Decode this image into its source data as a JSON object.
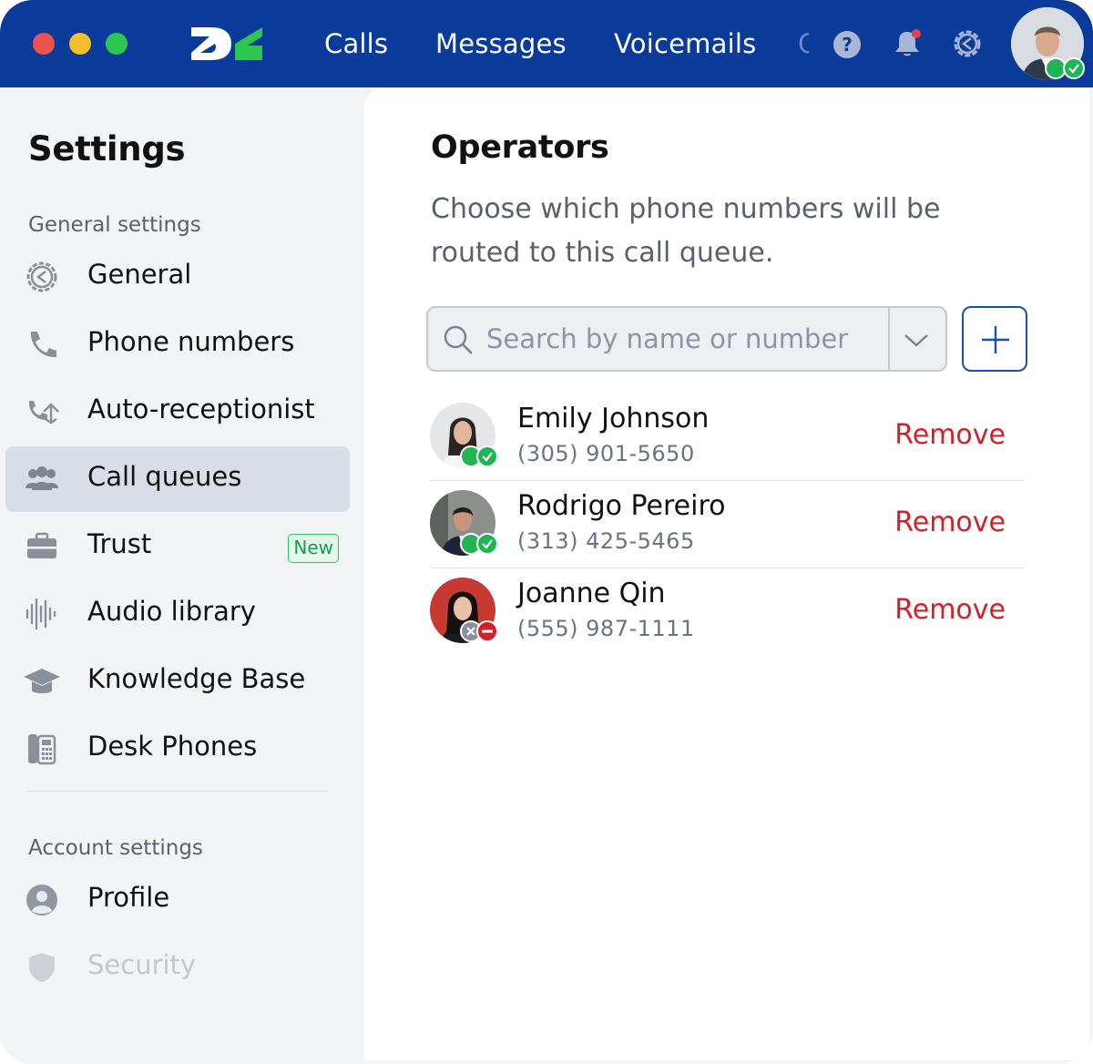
{
  "window": {
    "traffic_lights": [
      "close",
      "minimize",
      "maximize"
    ]
  },
  "topbar": {
    "colors": {
      "background": "#0a3b9a",
      "logo_white": "#ffffff",
      "logo_green": "#2dc650"
    },
    "nav": [
      {
        "label": "Calls"
      },
      {
        "label": "Messages"
      },
      {
        "label": "Voicemails"
      },
      {
        "label": "C"
      }
    ],
    "icons": [
      "help-icon",
      "bell-icon",
      "gear-icon"
    ],
    "user_status": "available"
  },
  "sidebar": {
    "title": "Settings",
    "general_label": "General settings",
    "items": [
      {
        "label": "General",
        "icon": "gear-icon"
      },
      {
        "label": "Phone numbers",
        "icon": "phone-icon"
      },
      {
        "label": "Auto-receptionist",
        "icon": "auto-receptionist-icon"
      },
      {
        "label": "Call queues",
        "icon": "people-icon",
        "active": true
      },
      {
        "label": "Trust",
        "icon": "briefcase-icon",
        "badge": "New"
      },
      {
        "label": "Audio library",
        "icon": "waveform-icon"
      },
      {
        "label": "Knowledge Base",
        "icon": "graduation-cap-icon"
      },
      {
        "label": "Desk Phones",
        "icon": "desk-phone-icon"
      }
    ],
    "account_label": "Account settings",
    "account_items": [
      {
        "label": "Profile",
        "icon": "user-icon"
      },
      {
        "label": "Security",
        "icon": "shield-icon"
      }
    ]
  },
  "main": {
    "title": "Operators",
    "description": "Choose which phone numbers will be routed to this call queue.",
    "search": {
      "placeholder": "Search by name or number",
      "value": ""
    },
    "add_icon": "plus-icon",
    "operators": [
      {
        "name": "Emily Johnson",
        "phone": "(305) 901-5650",
        "status": "available",
        "action": "Remove"
      },
      {
        "name": "Rodrigo Pereiro",
        "phone": "(313) 425-5465",
        "status": "available",
        "action": "Remove"
      },
      {
        "name": "Joanne Qin",
        "phone": "(555) 987-1111",
        "status": "do-not-disturb",
        "action": "Remove"
      }
    ],
    "colors": {
      "remove": "#d0202a",
      "accent": "#1a4fb4",
      "available": "#1fb455",
      "dnd": "#d0202a"
    }
  }
}
